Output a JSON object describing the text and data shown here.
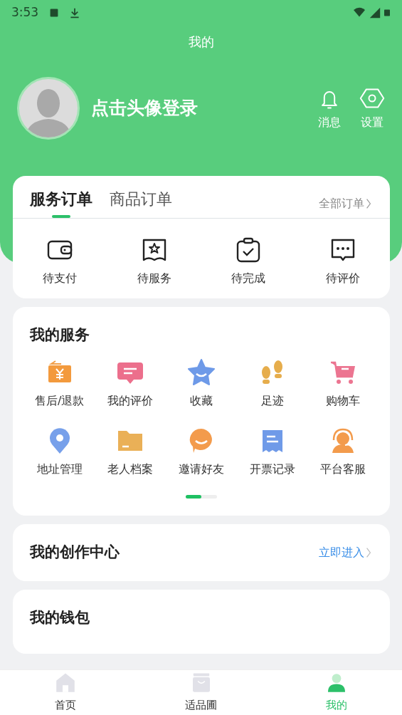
{
  "status_bar": {
    "time": "3:53"
  },
  "header": {
    "title": "我的",
    "login_prompt": "点击头像登录",
    "actions": [
      {
        "label": "消息"
      },
      {
        "label": "设置"
      }
    ]
  },
  "orders": {
    "tabs": [
      {
        "label": "服务订单",
        "selected": true
      },
      {
        "label": "商品订单",
        "selected": false
      }
    ],
    "all_link": "全部订单",
    "items": [
      {
        "label": "待支付"
      },
      {
        "label": "待服务"
      },
      {
        "label": "待完成"
      },
      {
        "label": "待评价"
      }
    ]
  },
  "services": {
    "title": "我的服务",
    "items": [
      {
        "label": "售后/退款"
      },
      {
        "label": "我的评价"
      },
      {
        "label": "收藏"
      },
      {
        "label": "足迹"
      },
      {
        "label": "购物车"
      },
      {
        "label": "地址管理"
      },
      {
        "label": "老人档案"
      },
      {
        "label": "邀请好友"
      },
      {
        "label": "开票记录"
      },
      {
        "label": "平台客服"
      }
    ]
  },
  "creation": {
    "title": "我的创作中心",
    "link": "立即进入"
  },
  "wallet": {
    "title": "我的钱包"
  },
  "tab_bar": [
    {
      "label": "首页",
      "selected": false
    },
    {
      "label": "适品圃",
      "selected": false
    },
    {
      "label": "我的",
      "selected": true
    }
  ]
}
